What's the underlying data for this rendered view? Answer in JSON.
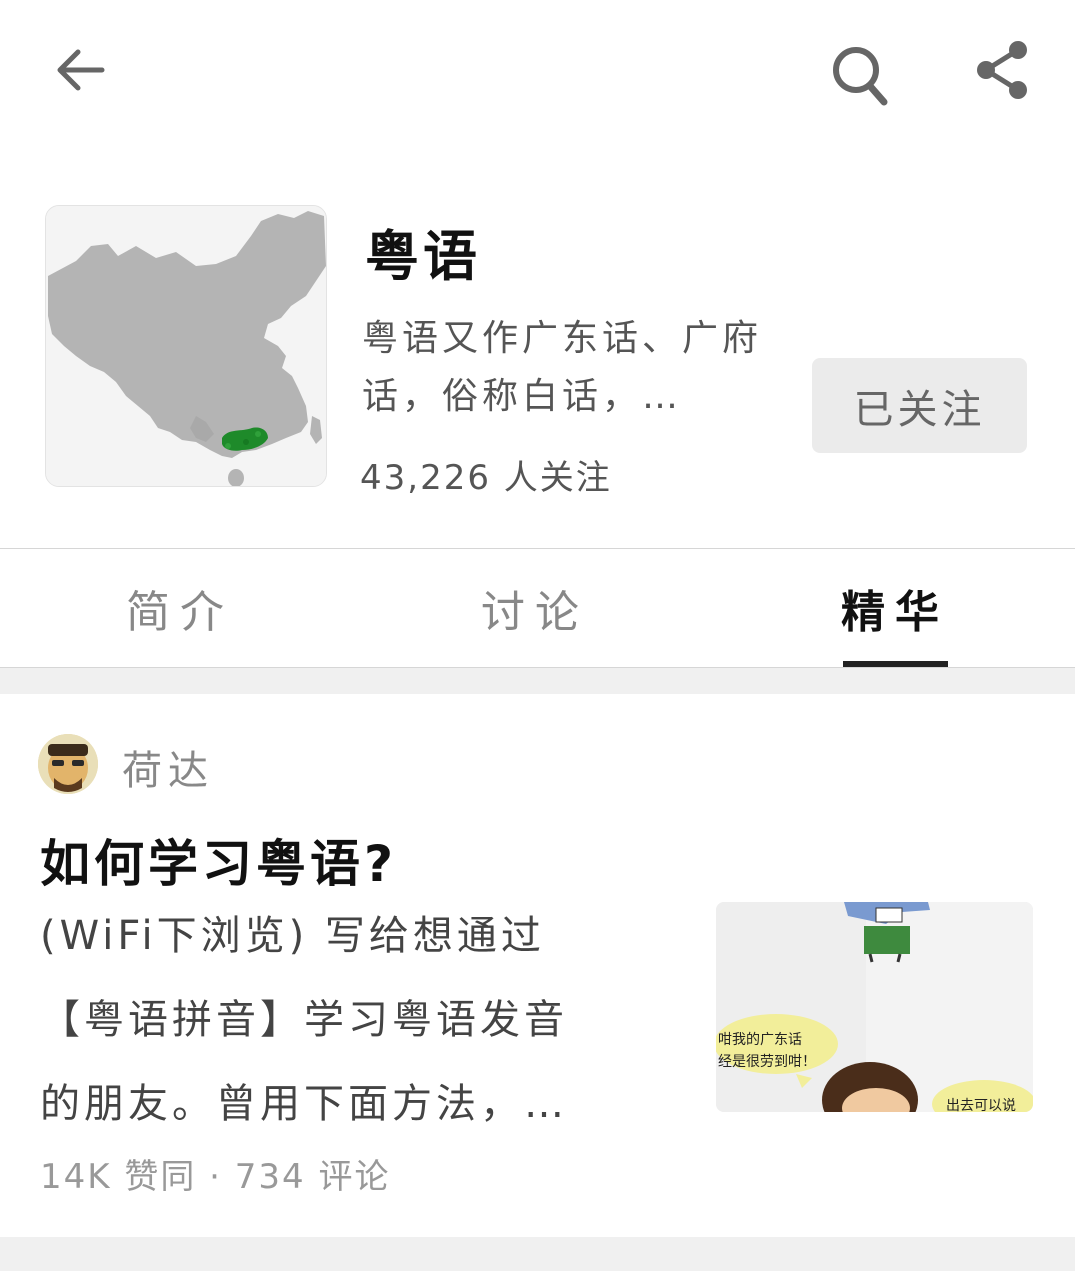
{
  "toolbar": {
    "back_icon": "arrow-left-icon",
    "search_icon": "search-icon",
    "share_icon": "share-icon"
  },
  "topic": {
    "title": "粤语",
    "description": "粤语又作广东话、广府话，俗称白话，…",
    "followers": "43,226 人关注",
    "follow_label": "已关注",
    "map_highlight_color": "#1e8a2a"
  },
  "tabs": [
    {
      "label": "简介"
    },
    {
      "label": "讨论"
    },
    {
      "label": "精华",
      "active": true
    }
  ],
  "feed": {
    "card": {
      "author": "荷达",
      "title": "如何学习粤语?",
      "excerpt_lines": [
        "(WiFi下浏览) 写给想通过",
        "【粤语拼音】学习粤语发音",
        "的朋友。曾用下面方法，…"
      ],
      "meta": "14K 赞同 · 734 评论",
      "thumb_bubbles": [
        "咁我的广东话",
        "经是很劳到咁！",
        "出去可以说"
      ]
    }
  }
}
